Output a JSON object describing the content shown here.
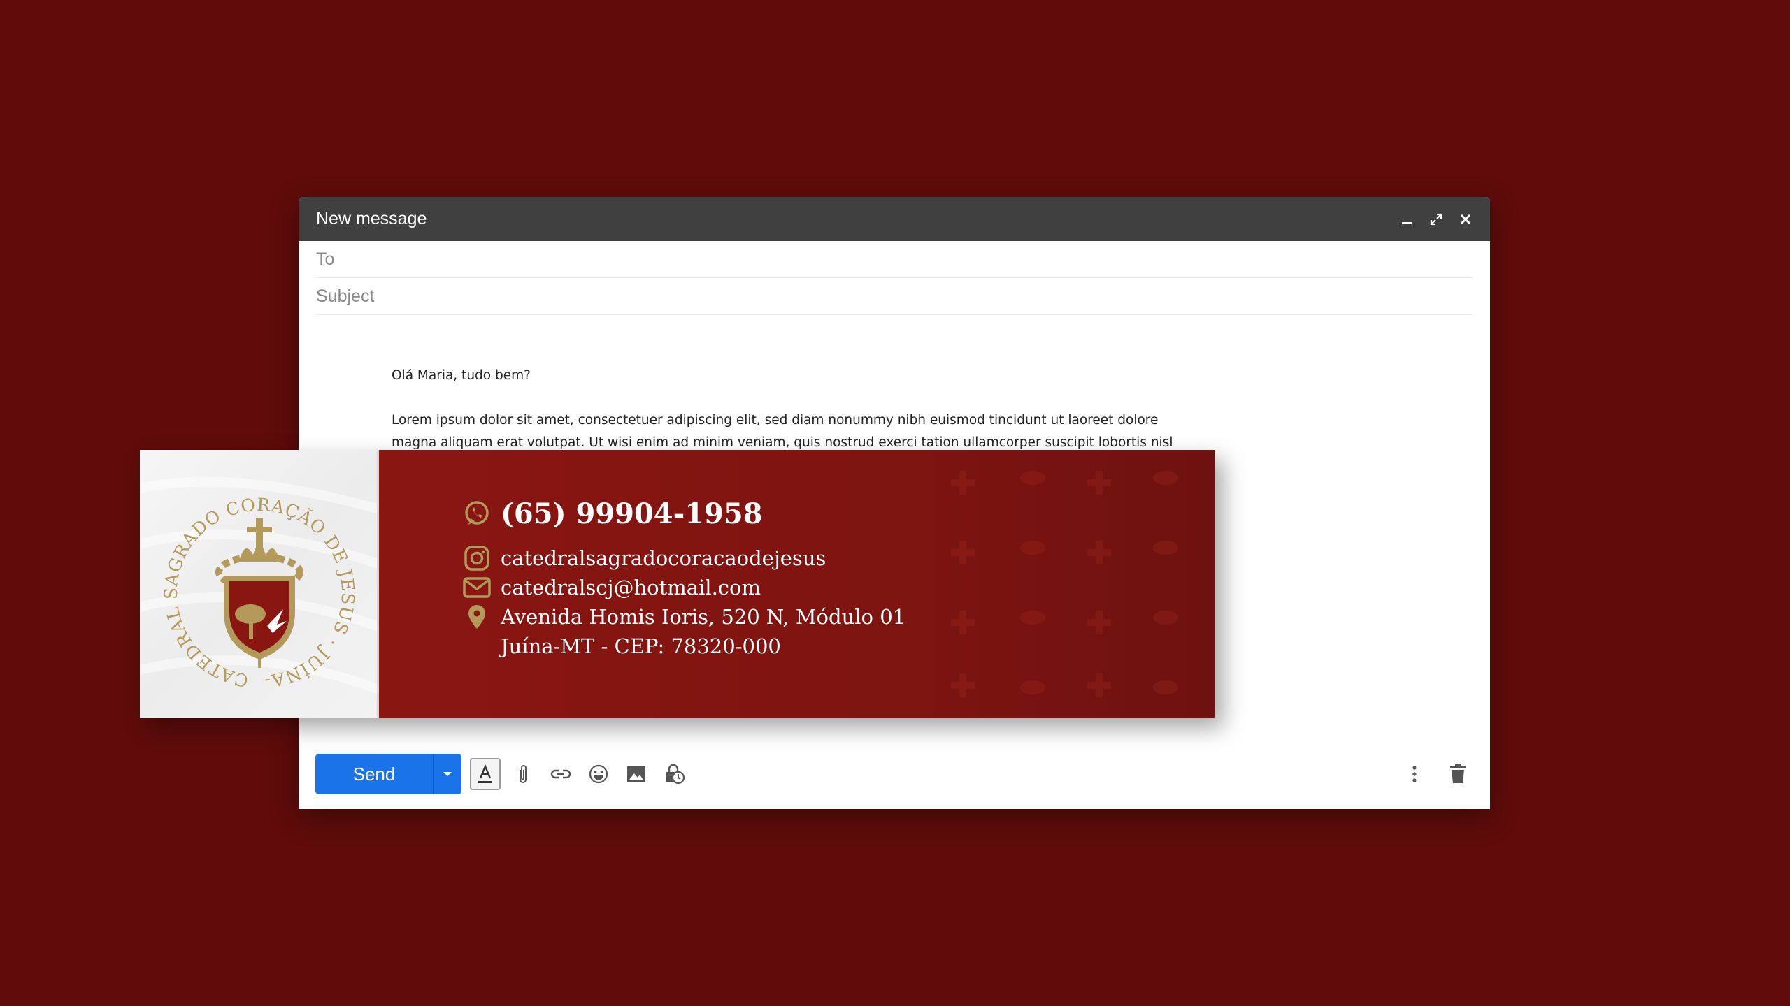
{
  "window": {
    "title": "New message"
  },
  "fields": {
    "to_label": "To",
    "subject_label": "Subject"
  },
  "message": {
    "greeting": "Olá Maria, tudo bem?",
    "line1": "Lorem ipsum dolor sit amet, consectetuer adipiscing elit, sed diam nonummy nibh euismod tincidunt ut laoreet dolore",
    "line2": "magna aliquam erat volutpat. Ut wisi enim ad minim veniam, quis nostrud exerci tation ullamcorper suscipit lobortis nisl"
  },
  "signature": {
    "logo_text": "CATEDRAL SAGRADO CORAÇÃO DE JESUS · JUÍNA-MT ·",
    "phone": "(65) 99904-1958",
    "instagram": "catedralsagradocoracaodejesus",
    "email": "catedralscj@hotmail.com",
    "address_line1": "Avenida Homis Ioris, 520 N, Módulo 01",
    "address_line2": "Juína-MT - CEP: 78320-000",
    "colors": {
      "red": "#8a1612",
      "gold": "#b39a5b"
    }
  },
  "toolbar": {
    "send_label": "Send"
  },
  "colors": {
    "background": "#5f0c0a",
    "titlebar": "#404040",
    "send": "#1a73e8"
  }
}
